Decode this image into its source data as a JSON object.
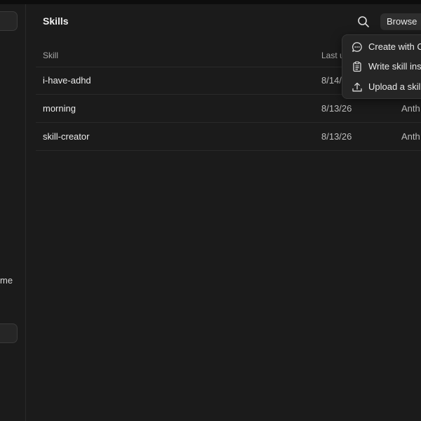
{
  "sidebar": {
    "partial_text": "me"
  },
  "header": {
    "title": "Skills",
    "browse_label": "Browse"
  },
  "table": {
    "columns": [
      "Skill",
      "Last u"
    ],
    "rows": [
      {
        "name": "i-have-adhd",
        "date": "8/14/",
        "author": ""
      },
      {
        "name": "morning",
        "date": "8/13/26",
        "author": "Anth"
      },
      {
        "name": "skill-creator",
        "date": "8/13/26",
        "author": "Anth"
      }
    ]
  },
  "menu": {
    "items": [
      {
        "label": "Create with C",
        "icon": "chat-bubble-icon"
      },
      {
        "label": "Write skill ins",
        "icon": "clipboard-icon"
      },
      {
        "label": "Upload a skill",
        "icon": "upload-icon"
      }
    ]
  }
}
